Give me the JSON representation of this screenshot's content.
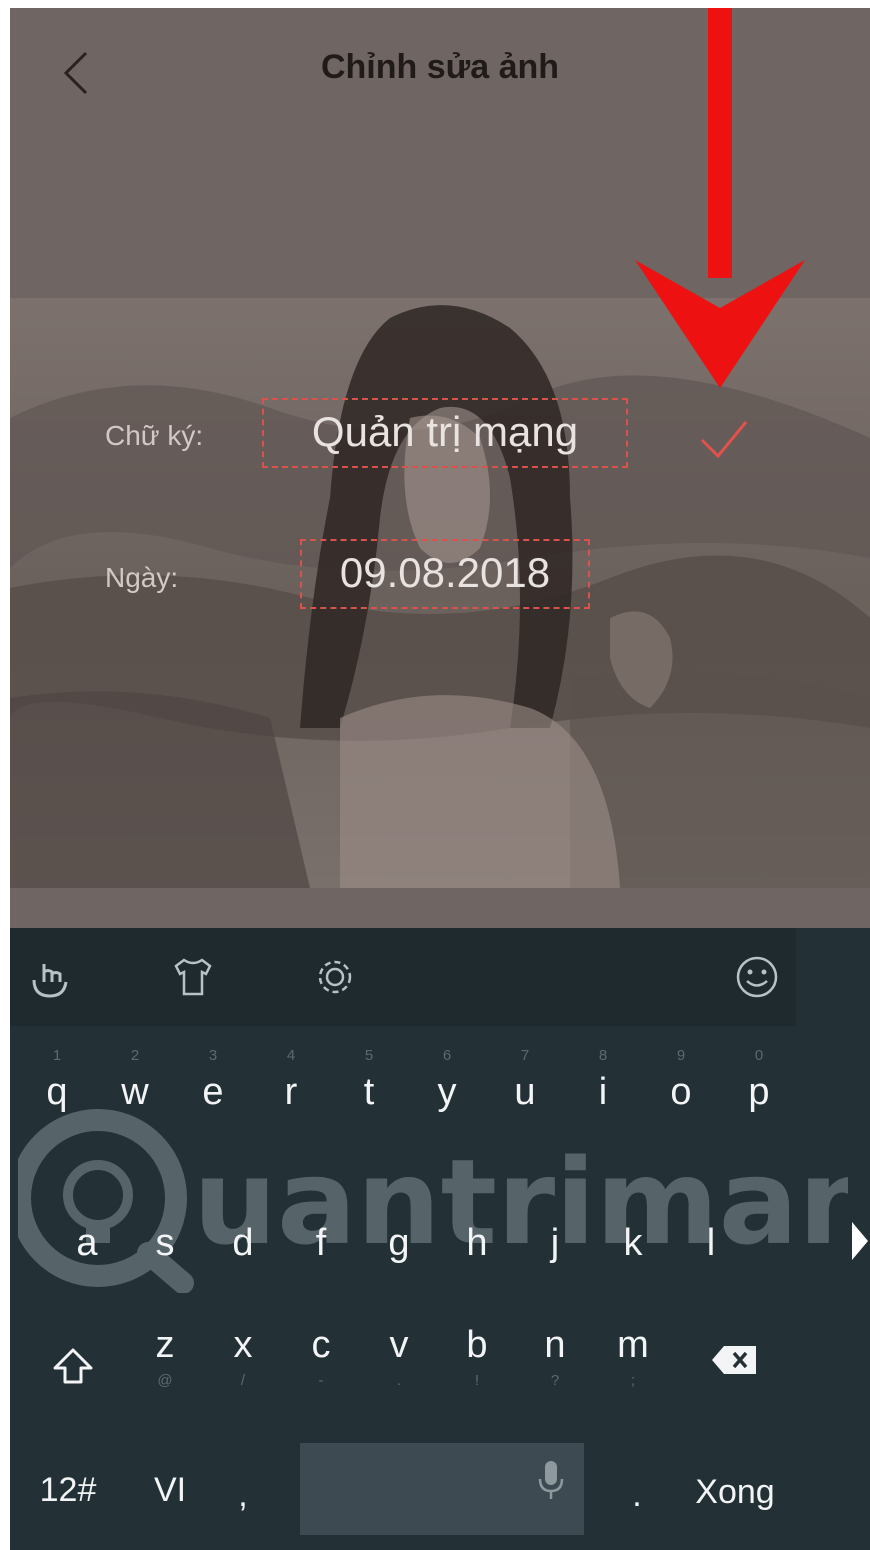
{
  "header": {
    "title": "Chỉnh sửa ảnh",
    "back_icon": "chevron-left-icon"
  },
  "form": {
    "signature_label": "Chữ ký:",
    "signature_value": "Quản trị mạng",
    "date_label": "Ngày:",
    "date_value": "09.08.2018",
    "confirm_icon": "check-icon",
    "accent_color": "#e0524b"
  },
  "annotation": {
    "arrow_color": "#ee1111"
  },
  "watermark": {
    "text": "uantrimang"
  },
  "keyboard": {
    "toolbar_icons": [
      "hand-tap-icon",
      "tshirt-icon",
      "gear-icon",
      "smiley-icon"
    ],
    "row1": [
      {
        "key": "q",
        "hint": "1"
      },
      {
        "key": "w",
        "hint": "2"
      },
      {
        "key": "e",
        "hint": "3"
      },
      {
        "key": "r",
        "hint": "4"
      },
      {
        "key": "t",
        "hint": "5"
      },
      {
        "key": "y",
        "hint": "6"
      },
      {
        "key": "u",
        "hint": "7"
      },
      {
        "key": "i",
        "hint": "8"
      },
      {
        "key": "o",
        "hint": "9"
      },
      {
        "key": "p",
        "hint": "0"
      }
    ],
    "row2": [
      "a",
      "s",
      "d",
      "f",
      "g",
      "h",
      "j",
      "k",
      "l"
    ],
    "row3": [
      {
        "key": "z",
        "hint": "@"
      },
      {
        "key": "x",
        "hint": "/"
      },
      {
        "key": "c",
        "hint": "-"
      },
      {
        "key": "v",
        "hint": "."
      },
      {
        "key": "b",
        "hint": "!"
      },
      {
        "key": "n",
        "hint": "?"
      },
      {
        "key": "m",
        "hint": ";"
      }
    ],
    "bottom": {
      "symbols": "12#",
      "language": "VI",
      "comma": ",",
      "period": ".",
      "done": "Xong"
    }
  }
}
